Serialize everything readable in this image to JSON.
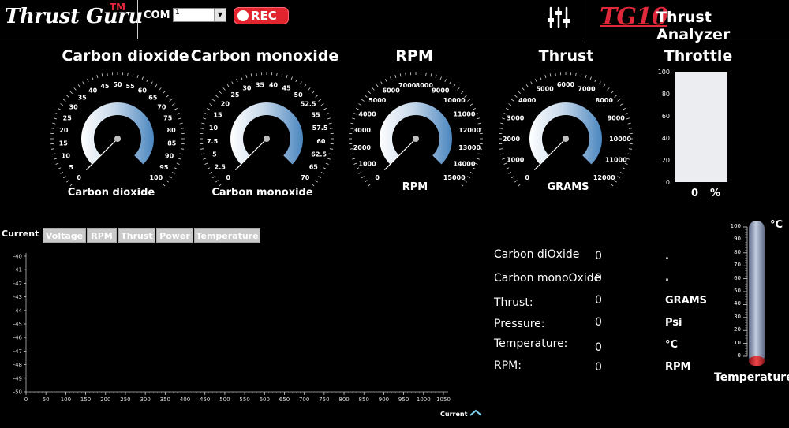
{
  "header": {
    "logo": "Thrust Guru",
    "logo_tm": "TM",
    "com_label": "COM",
    "com_value": "1",
    "rec_label": "REC",
    "settings_icon": "sliders-icon",
    "tg_logo": "TG10",
    "app_title": "Thrust Analyzer"
  },
  "colors": {
    "accent": "#e2242e",
    "gauge_start": "#ffffff",
    "gauge_end": "#4a86bf",
    "thermo_body": "#9ba7c0",
    "thermo_bulb": "#d9262c"
  },
  "gauges": [
    {
      "title": "Carbon dioxide",
      "caption": "Carbon dioxide",
      "min": 0,
      "max": 100,
      "value": 0,
      "ticks": [
        "0",
        "5",
        "10",
        "15",
        "20",
        "25",
        "30",
        "35",
        "40",
        "45",
        "50",
        "55",
        "60",
        "65",
        "70",
        "75",
        "80",
        "85",
        "90",
        "95",
        "100"
      ]
    },
    {
      "title": "Carbon monoxide",
      "caption": "Carbon monoxide",
      "min": 0,
      "max": 70,
      "value": 0,
      "ticks": [
        "0",
        "2.5",
        "5",
        "7.5",
        "10",
        "15",
        "20",
        "25",
        "30",
        "35",
        "40",
        "45",
        "50",
        "52.5",
        "55",
        "57.5",
        "60",
        "62.5",
        "65",
        "70"
      ]
    },
    {
      "title": "RPM",
      "caption": "RPM",
      "min": 0,
      "max": 15000,
      "value": 0,
      "ticks": [
        "0",
        "1000",
        "2000",
        "3000",
        "4000",
        "5000",
        "6000",
        "7000",
        "8000",
        "9000",
        "10000",
        "11000",
        "12000",
        "13000",
        "14000",
        "15000"
      ]
    },
    {
      "title": "Thrust",
      "caption": "GRAMS",
      "min": 0,
      "max": 12000,
      "value": 0,
      "ticks": [
        "0",
        "1000",
        "2000",
        "3000",
        "4000",
        "5000",
        "6000",
        "7000",
        "8000",
        "9000",
        "10000",
        "11000",
        "12000"
      ]
    }
  ],
  "throttle": {
    "title": "Throttle",
    "value": "0",
    "unit": "%",
    "level": 0,
    "ticks": [
      "100",
      "80",
      "60",
      "40",
      "20",
      "0"
    ]
  },
  "tabs": {
    "current": "Current",
    "items": [
      "Voltage",
      "RPM",
      "Thrust",
      "Power",
      "Temperature"
    ]
  },
  "chart_data": {
    "type": "line",
    "series": [
      {
        "name": "Current",
        "values": []
      }
    ],
    "x_ticks": [
      "0",
      "50",
      "100",
      "150",
      "200",
      "250",
      "300",
      "350",
      "400",
      "450",
      "500",
      "550",
      "600",
      "650",
      "700",
      "750",
      "800",
      "850",
      "900",
      "950",
      "1000",
      "1050"
    ],
    "y_ticks": [
      "-40",
      "-41",
      "-42",
      "-43",
      "-44",
      "-45",
      "-46",
      "-47",
      "-48",
      "-49",
      "-50"
    ],
    "xlim": [
      0,
      1050
    ],
    "ylim": [
      -50,
      -40
    ],
    "legend": "Current"
  },
  "readings": [
    {
      "label": "Carbon diOxide",
      "value": "0",
      "unit": "."
    },
    {
      "label": "Carbon monoOxide",
      "value": "0",
      "unit": "."
    },
    {
      "label": "Thrust:",
      "value": "0",
      "unit": "GRAMS"
    },
    {
      "label": "Pressure:",
      "value": "0",
      "unit": "Psi"
    },
    {
      "label": "Temperature:",
      "value": "0",
      "unit": "°C"
    },
    {
      "label": "RPM:",
      "value": "0",
      "unit": "RPM"
    }
  ],
  "thermometer": {
    "unit": "°C",
    "label": "Temperature",
    "level": 0,
    "ticks": [
      "100",
      "90",
      "80",
      "70",
      "60",
      "50",
      "40",
      "30",
      "20",
      "10",
      "0"
    ]
  }
}
